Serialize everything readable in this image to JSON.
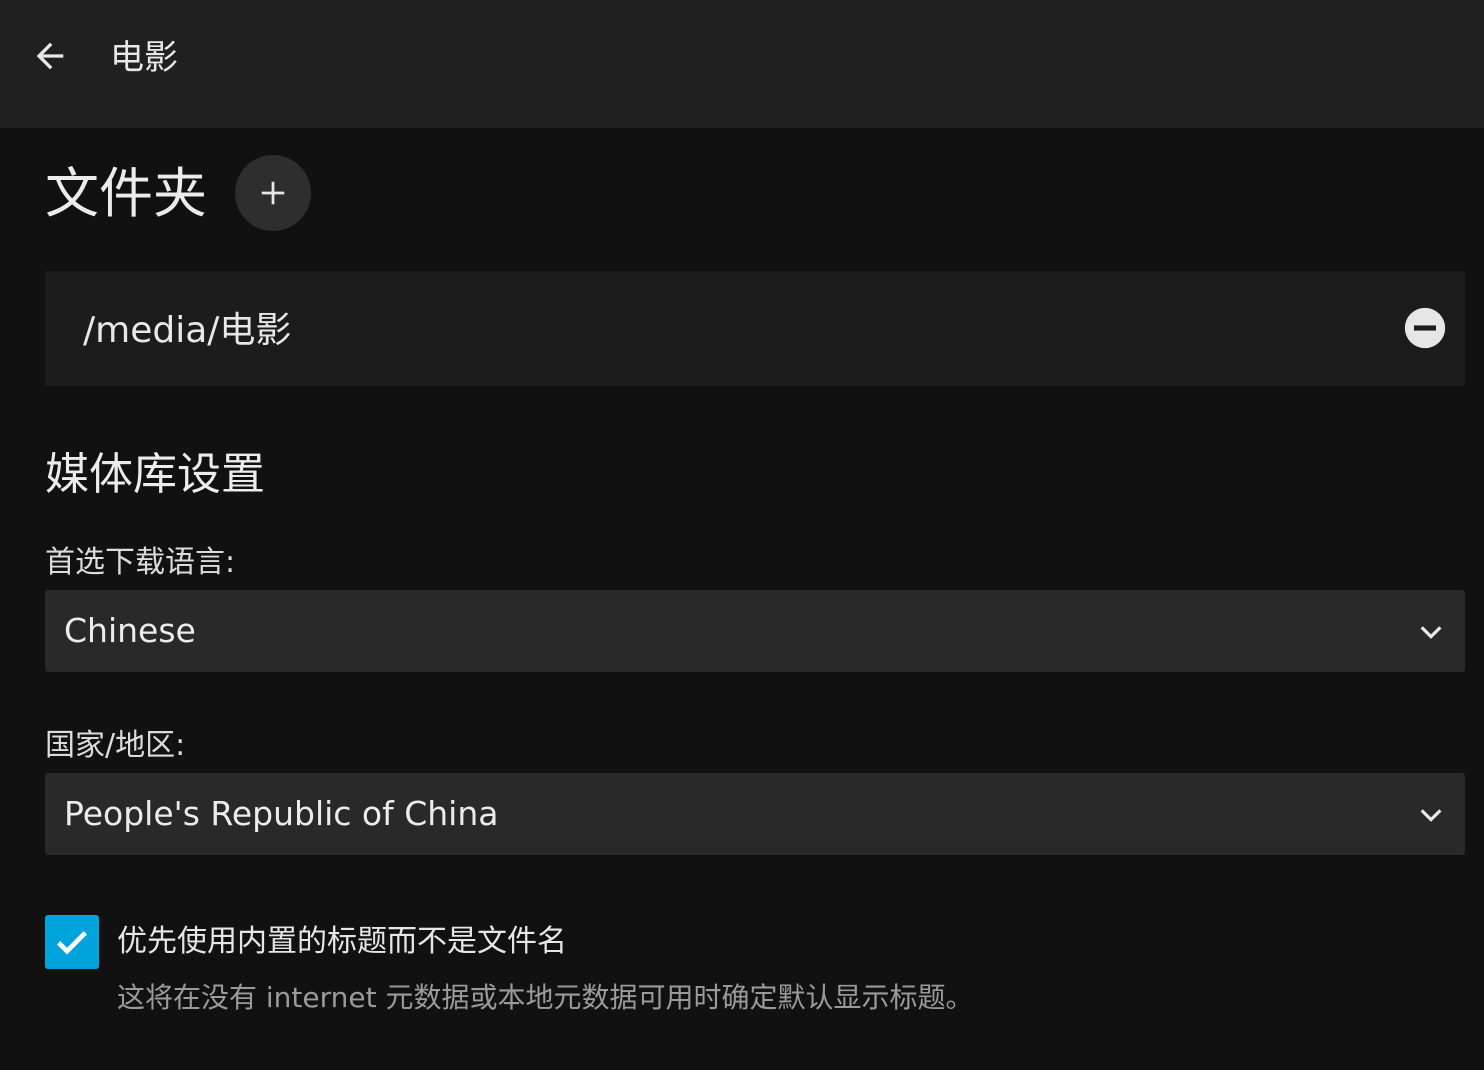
{
  "header": {
    "back_icon": "arrow-left-icon",
    "title": "电影"
  },
  "folders": {
    "title": "文件夹",
    "add_icon": "plus-icon",
    "items": [
      {
        "path": "/media/电影",
        "remove_icon": "minus-circle-icon"
      }
    ]
  },
  "library_settings": {
    "title": "媒体库设置",
    "preferred_language": {
      "label": "首选下载语言:",
      "value": "Chinese",
      "icon": "chevron-down-icon"
    },
    "country": {
      "label": "国家/地区:",
      "value": "People's Republic of China",
      "icon": "chevron-down-icon"
    },
    "prefer_embedded_titles": {
      "checked": true,
      "label": "优先使用内置的标题而不是文件名",
      "description": "这将在没有 internet 元数据或本地元数据可用时确定默认显示标题。"
    }
  },
  "colors": {
    "background": "#111111",
    "header": "#202020",
    "accent": "#00a4dc",
    "select_bg": "#292929"
  }
}
